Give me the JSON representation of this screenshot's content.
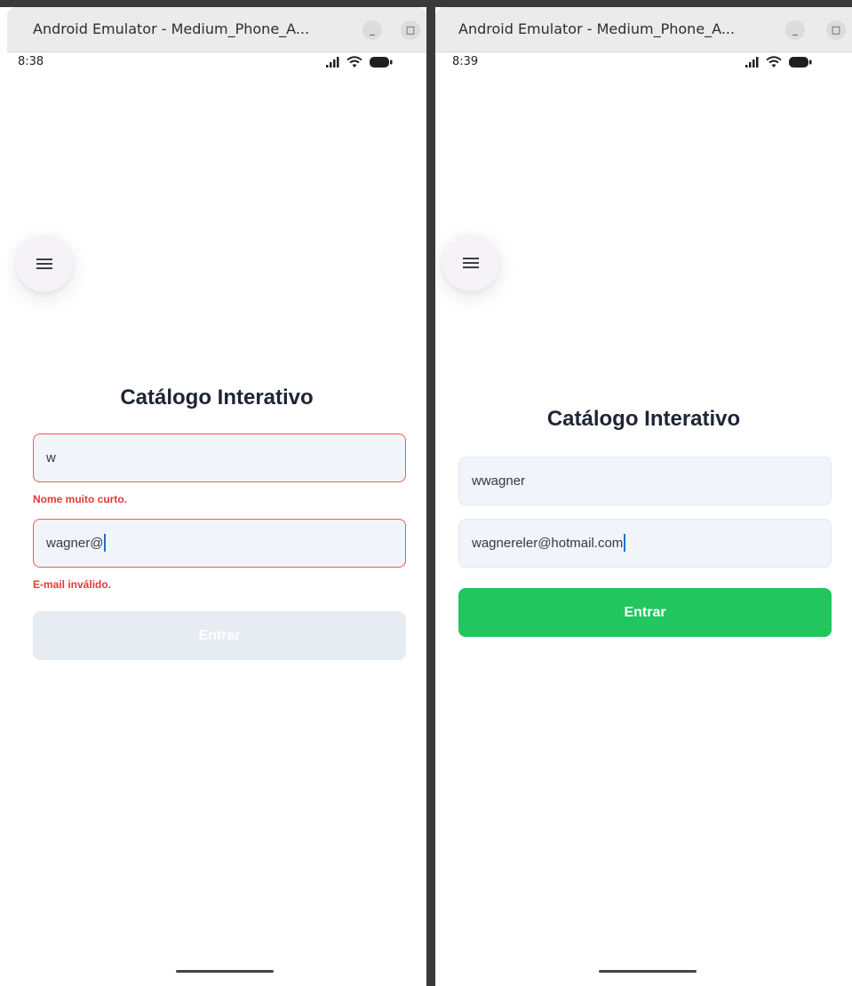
{
  "left_window": {
    "title": "Android Emulator - Medium_Phone_A...",
    "minimize_glyph": "_",
    "maximize_glyph": "□",
    "status_time": "8:38",
    "app_title": "Catálogo Interativo",
    "name_field_value": "w",
    "name_error": "Nome muito curto.",
    "email_field_value": "wagner@",
    "email_error": "E-mail inválido.",
    "submit_label": "Entrar",
    "submit_state": "disabled"
  },
  "right_window": {
    "title": "Android Emulator - Medium_Phone_A...",
    "minimize_glyph": "_",
    "maximize_glyph": "□",
    "status_time": "8:39",
    "app_title": "Catálogo Interativo",
    "name_field_value": "wwagner",
    "email_field_value": "wagnereler@hotmail.com",
    "submit_label": "Entrar",
    "submit_state": "enabled"
  },
  "icons": {
    "menu": "hamburger-menu-icon",
    "signal": "cell-signal-icon",
    "wifi": "wifi-icon",
    "battery": "battery-icon"
  },
  "colors": {
    "error": "#e53935",
    "error_border": "#ef5a5a",
    "submit_enabled": "#22c55e",
    "submit_disabled": "#e7ecf2",
    "field_bg": "#f1f4f8",
    "title_text": "#1e2535"
  }
}
